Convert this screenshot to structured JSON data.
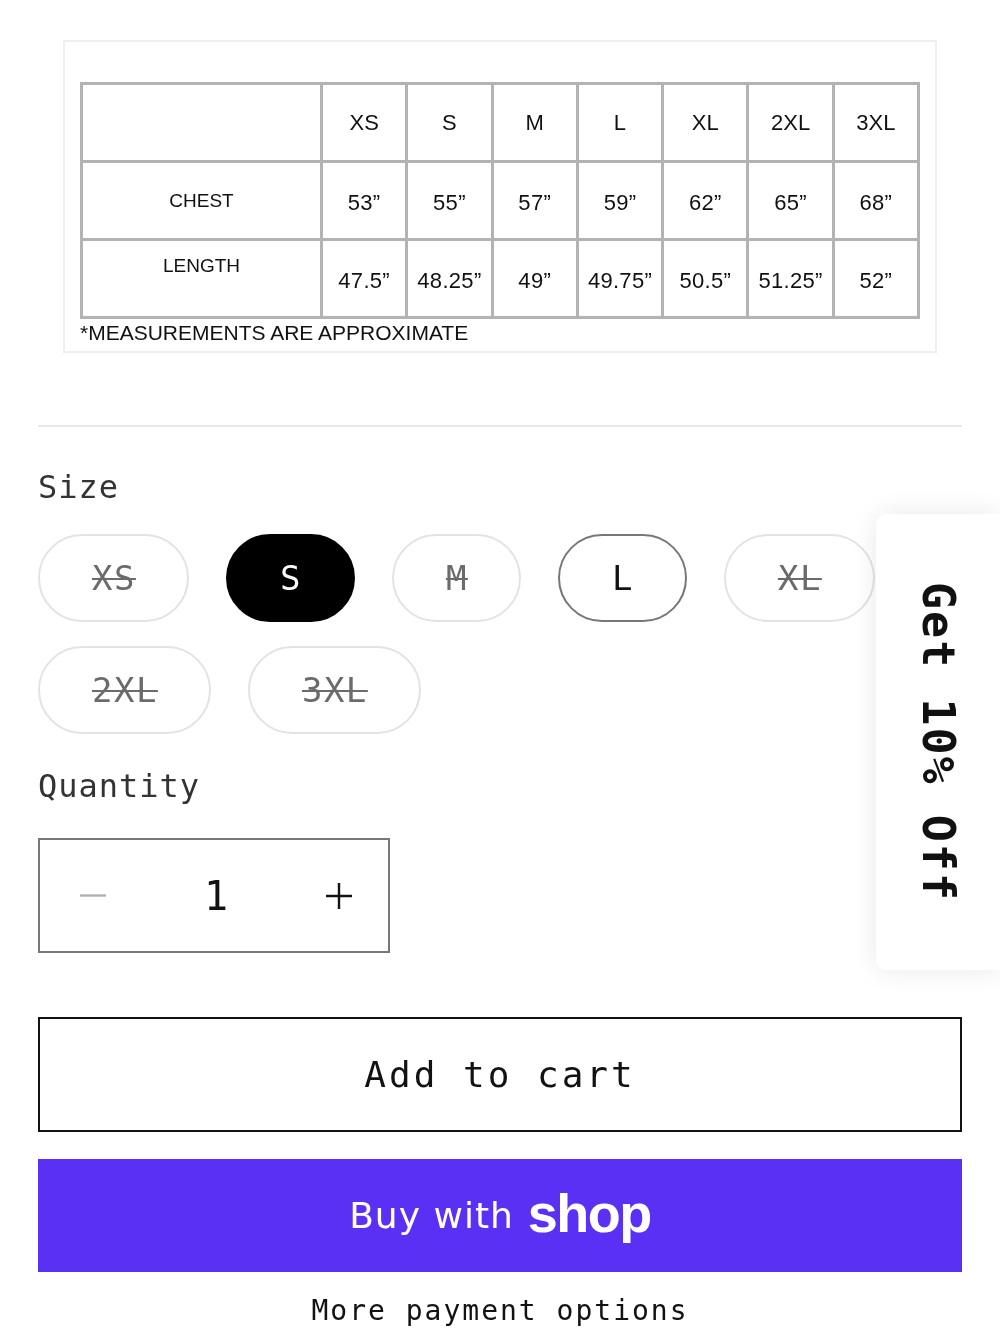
{
  "size_chart": {
    "columns": [
      "XS",
      "S",
      "M",
      "L",
      "XL",
      "2XL",
      "3XL"
    ],
    "rows": [
      {
        "label": "CHEST",
        "values": [
          "53”",
          "55”",
          "57”",
          "59”",
          "62”",
          "65”",
          "68”"
        ]
      },
      {
        "label": "LENGTH",
        "values": [
          "47.5”",
          "48.25”",
          "49”",
          "49.75”",
          "50.5”",
          "51.25”",
          "52”"
        ]
      }
    ],
    "note": "*MEASUREMENTS ARE APPROXIMATE"
  },
  "size": {
    "label": "Size",
    "options": [
      {
        "label": "XS",
        "selected": false,
        "available": false
      },
      {
        "label": "S",
        "selected": true,
        "available": true
      },
      {
        "label": "M",
        "selected": false,
        "available": false
      },
      {
        "label": "L",
        "selected": false,
        "available": true
      },
      {
        "label": "XL",
        "selected": false,
        "available": false
      },
      {
        "label": "2XL",
        "selected": false,
        "available": false
      },
      {
        "label": "3XL",
        "selected": false,
        "available": false
      }
    ]
  },
  "quantity": {
    "label": "Quantity",
    "value": "1",
    "decrease_disabled": true
  },
  "add_to_cart": {
    "label": "Add to cart"
  },
  "buy_with_shop": {
    "label": "Buy with",
    "logo": "shop"
  },
  "more_payment_options": {
    "label": "More payment options"
  },
  "discount_tab": {
    "label": "Get 10% Off"
  }
}
